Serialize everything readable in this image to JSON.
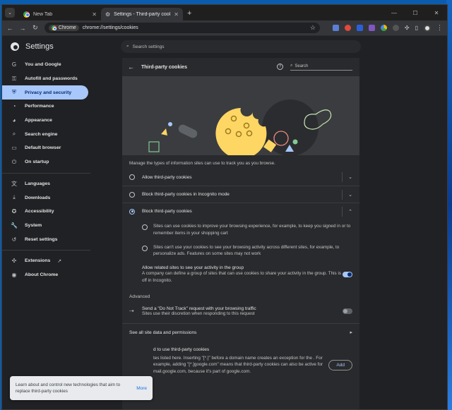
{
  "colors": {
    "accent": "#a8c7fa",
    "surface": "#292a2d",
    "background": "#202124",
    "illustration_bg": "#3b3c3f",
    "cookie_yellow": "#fdd663",
    "toast_link": "#1a73e8"
  },
  "tabs": [
    {
      "title": "New Tab",
      "icon": "chrome-icon",
      "active": false
    },
    {
      "title": "Settings - Third-party cookies",
      "icon": "gear-icon",
      "active": true
    }
  ],
  "toolbar": {
    "chip_label": "Chrome",
    "url": "chrome://settings/cookies"
  },
  "settings": {
    "title": "Settings",
    "search_placeholder": "Search settings"
  },
  "sidebar": {
    "items": [
      {
        "label": "You and Google",
        "icon": "google-icon",
        "glyph": "G"
      },
      {
        "label": "Autofill and passwords",
        "icon": "key-icon",
        "glyph": "⚿"
      },
      {
        "label": "Privacy and security",
        "icon": "shield-icon",
        "glyph": "⛨",
        "active": true
      },
      {
        "label": "Performance",
        "icon": "speedometer-icon",
        "glyph": "◔"
      },
      {
        "label": "Appearance",
        "icon": "palette-icon",
        "glyph": "◕"
      },
      {
        "label": "Search engine",
        "icon": "search-icon",
        "glyph": "⌕"
      },
      {
        "label": "Default browser",
        "icon": "browser-icon",
        "glyph": "▭"
      },
      {
        "label": "On startup",
        "icon": "power-icon",
        "glyph": "⏻"
      }
    ],
    "items2": [
      {
        "label": "Languages",
        "icon": "translate-icon",
        "glyph": "文"
      },
      {
        "label": "Downloads",
        "icon": "download-icon",
        "glyph": "⤓"
      },
      {
        "label": "Accessibility",
        "icon": "accessibility-icon",
        "glyph": "✪"
      },
      {
        "label": "System",
        "icon": "wrench-icon",
        "glyph": "🔧"
      },
      {
        "label": "Reset settings",
        "icon": "reset-icon",
        "glyph": "↺"
      }
    ],
    "items3": [
      {
        "label": "Extensions",
        "icon": "puzzle-icon",
        "glyph": "✣",
        "external": "↗"
      },
      {
        "label": "About Chrome",
        "icon": "chrome-icon",
        "glyph": "◉"
      }
    ]
  },
  "panel": {
    "title": "Third-party cookies",
    "search_placeholder": "Search",
    "description": "Manage the types of information sites can use to track you as you browse.",
    "options": [
      {
        "label": "Allow third-party cookies",
        "selected": false,
        "expanded": false
      },
      {
        "label": "Block third-party cookies in Incognito mode",
        "selected": false,
        "expanded": false
      },
      {
        "label": "Block third-party cookies",
        "selected": true,
        "expanded": true
      }
    ],
    "sub_items": [
      {
        "icon": "cookie-icon",
        "text": "Sites can use cookies to improve your browsing experience, for example, to keep you signed in or to remember items in your shopping cart"
      },
      {
        "icon": "block-icon",
        "text": "Sites can't use your cookies to see your browsing activity across different sites, for example, to personalize ads. Features on some sites may not work"
      }
    ],
    "related": {
      "heading": "Allow related sites to see your activity in the group",
      "desc": "A company can define a group of sites that can use cookies to share your activity in the group. This is off in Incognito.",
      "enabled": true
    },
    "advanced_heading": "Advanced",
    "dnt": {
      "heading": "Send a \"Do Not Track\" request with your browsing traffic",
      "desc": "Sites use their discretion when responding to this request",
      "enabled": false
    },
    "site_data_link": "See all site data and permissions",
    "allowed_heading": "d to use third-party cookies",
    "allowed_desc": "tes listed here. Inserting \"[*.]\" before a domain name creates an exception for the  . For example, adding \"[*.]google.com\" means that third-party cookies can also be active for mail.google.com, because it's part of google.com.",
    "add_button": "Add"
  },
  "toast": {
    "message": "Learn about and control new technologies that aim to replace third-party cookies",
    "action": "More"
  }
}
